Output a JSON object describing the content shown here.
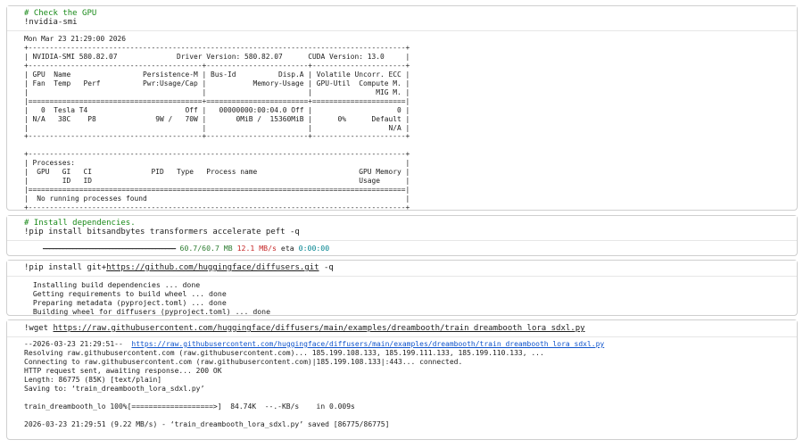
{
  "cells": [
    {
      "comment": "# Check the GPU",
      "code": "!nvidia-smi",
      "output_lines": [
        "Mon Mar 23 21:29:00 2026",
        "+-----------------------------------------------------------------------------------------+",
        "| NVIDIA-SMI 580.82.07              Driver Version: 580.82.07      CUDA Version: 13.0     |",
        "+-----------------------------------------+------------------------+----------------------+",
        "| GPU  Name                 Persistence-M | Bus-Id          Disp.A | Volatile Uncorr. ECC |",
        "| Fan  Temp   Perf          Pwr:Usage/Cap |           Memory-Usage | GPU-Util  Compute M. |",
        "|                                         |                        |               MIG M. |",
        "|=========================================+========================+======================|",
        "|   0  Tesla T4                       Off |   00000000:00:04.0 Off |                    0 |",
        "| N/A   38C    P8              9W /   70W |       0MiB /  15360MiB |      0%      Default |",
        "|                                         |                        |                  N/A |",
        "+-----------------------------------------+------------------------+----------------------+",
        "",
        "+-----------------------------------------------------------------------------------------+",
        "| Processes:                                                                              |",
        "|  GPU   GI   CI              PID   Type   Process name                        GPU Memory |",
        "|        ID   ID                                                               Usage      |",
        "|=========================================================================================|",
        "|  No running processes found                                                             |",
        "+-----------------------------------------------------------------------------------------+"
      ]
    },
    {
      "comment": "# Install dependencies.",
      "code": "!pip install bitsandbytes transformers accelerate peft -q",
      "progress": {
        "bar": "━━━━━━━━━━━━━━━━━━━━━━━━━━━━━━━━━━━━━━━━",
        "size": "60.7/60.7 MB",
        "speed": "12.1 MB/s",
        "eta_label": "eta",
        "eta": "0:00:00"
      }
    },
    {
      "code_prefix": "!pip install git+",
      "code_link": "https://github.com/huggingface/diffusers.git",
      "code_suffix": " -q",
      "output_lines": [
        "  Installing build dependencies ... done",
        "  Getting requirements to build wheel ... done",
        "  Preparing metadata (pyproject.toml) ... done",
        "  Building wheel for diffusers (pyproject.toml) ... done"
      ]
    },
    {
      "code_prefix": "!wget ",
      "code_link": "https://raw.githubusercontent.com/huggingface/diffusers/main/examples/dreambooth/train_dreambooth_lora_sdxl.py",
      "output_first_prefix": "--2026-03-23 21:29:51--  ",
      "output_first_link": "https://raw.githubusercontent.com/huggingface/diffusers/main/examples/dreambooth/train_dreambooth_lora_sdxl.py",
      "output_lines": [
        "Resolving raw.githubusercontent.com (raw.githubusercontent.com)... 185.199.108.133, 185.199.111.133, 185.199.110.133, ...",
        "Connecting to raw.githubusercontent.com (raw.githubusercontent.com)|185.199.108.133|:443... connected.",
        "HTTP request sent, awaiting response... 200 OK",
        "Length: 86775 (85K) [text/plain]",
        "Saving to: ‘train_dreambooth_lora_sdxl.py’",
        "",
        "train_dreambooth_lo 100%[===================>]  84.74K  --.-KB/s    in 0.009s",
        "",
        "2026-03-23 21:29:51 (9.22 MB/s) - ‘train_dreambooth_lora_sdxl.py’ saved [86775/86775]"
      ]
    }
  ]
}
